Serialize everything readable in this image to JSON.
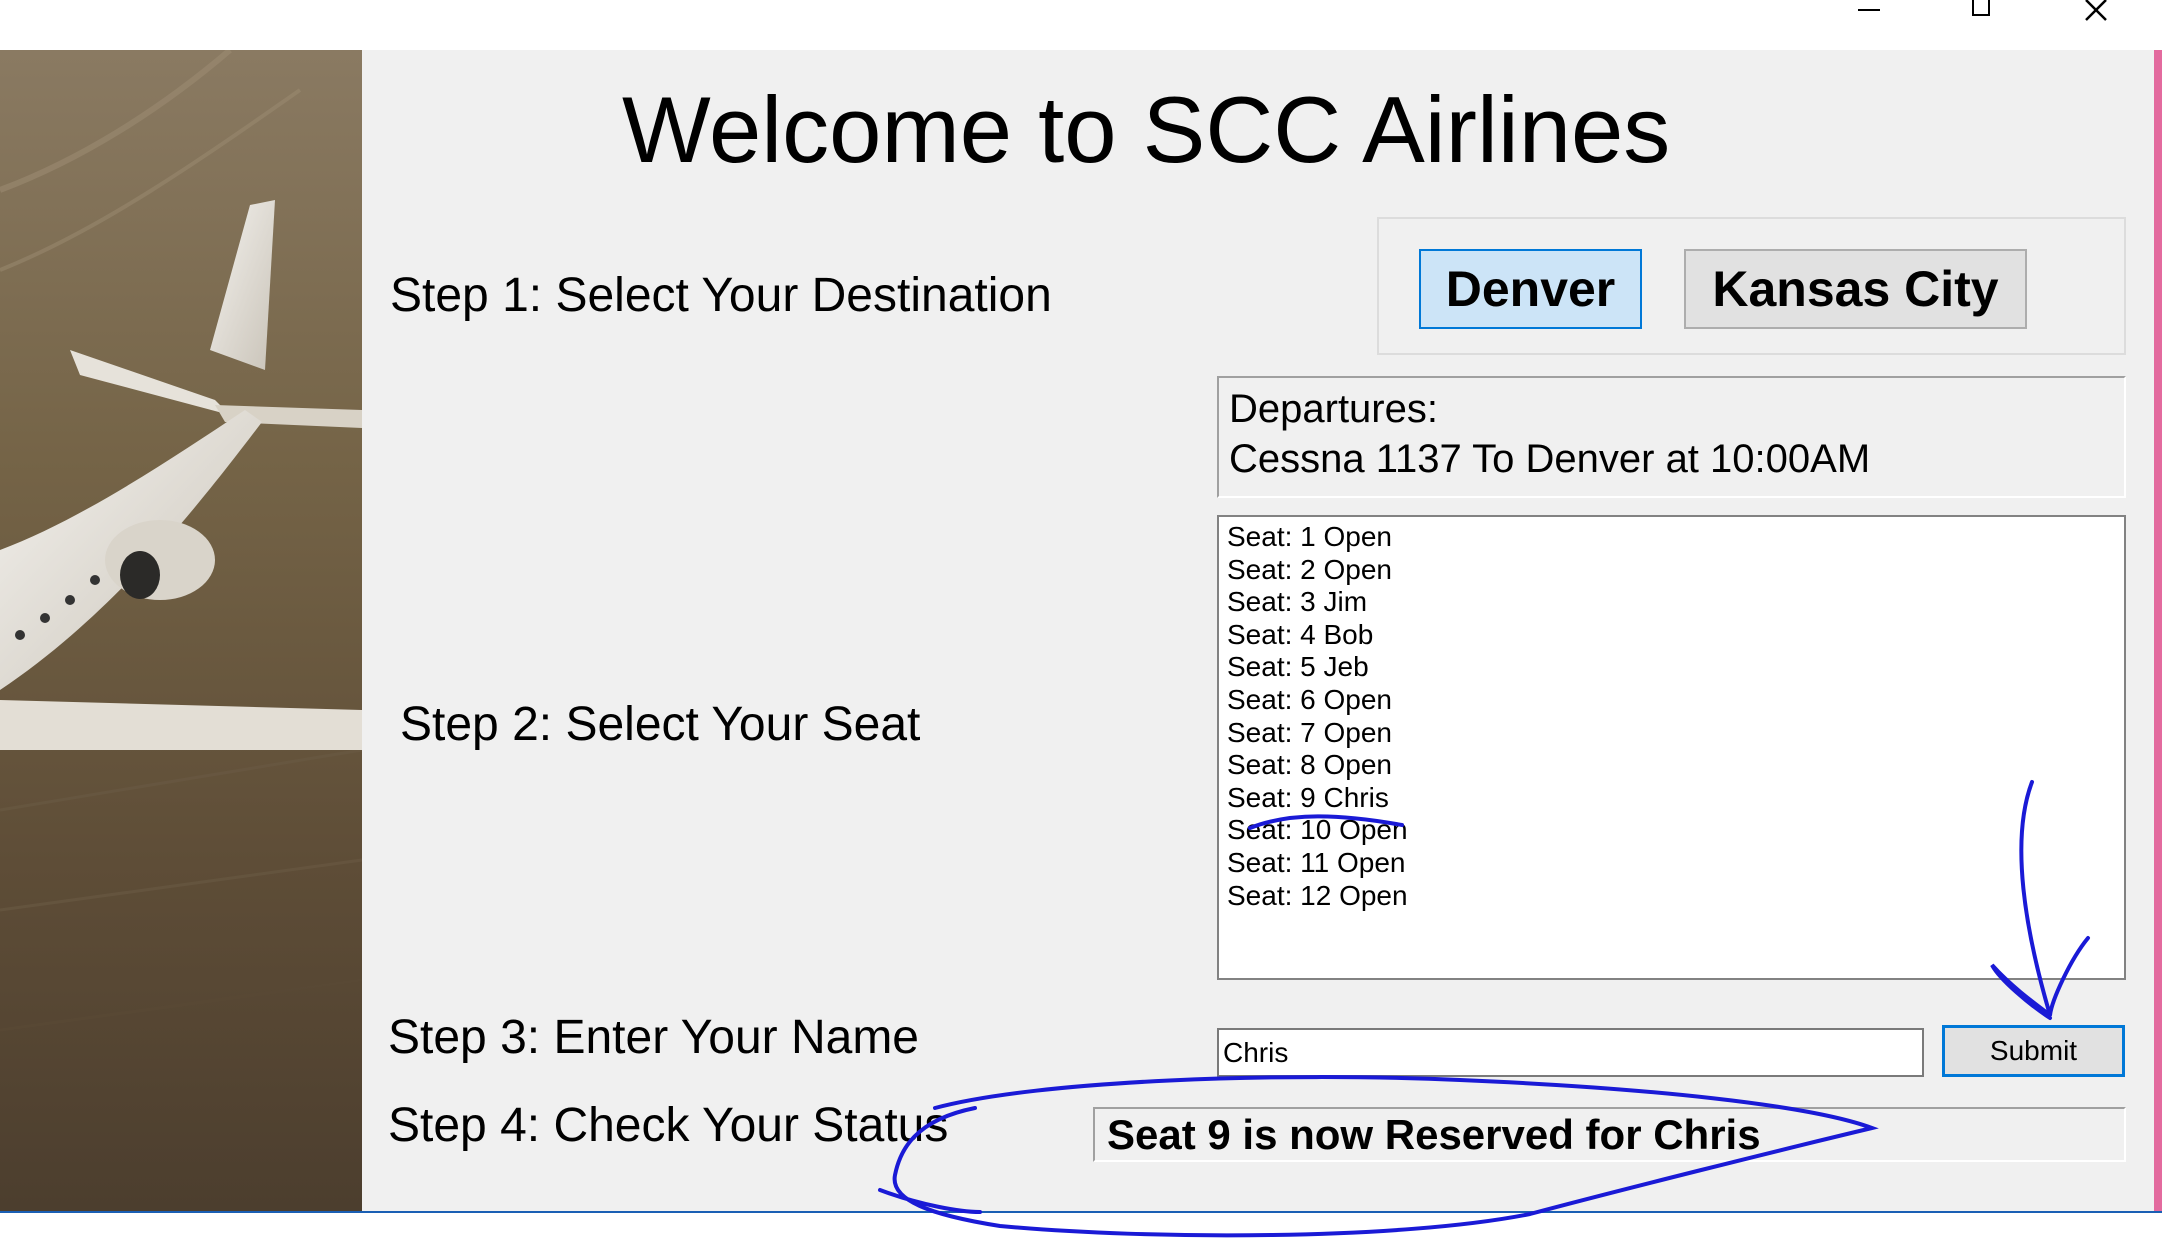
{
  "app": {
    "title": "Welcome to SCC Airlines"
  },
  "window_controls": {
    "minimize_icon": "minimize-icon",
    "maximize_icon": "maximize-icon",
    "close_icon": "close-icon"
  },
  "steps": {
    "step1": "Step 1: Select Your Destination",
    "step2": "Step 2: Select Your Seat",
    "step3": "Step 3: Enter Your Name",
    "step4": "Step 4: Check Your Status"
  },
  "destinations": {
    "denver": "Denver",
    "kansas_city": "Kansas City"
  },
  "departures": {
    "heading": "Departures:",
    "flight": "Cessna 1137 To Denver at 10:00AM"
  },
  "seats": [
    "Seat: 1 Open",
    "Seat: 2 Open",
    "Seat: 3 Jim",
    "Seat: 4 Bob",
    "Seat: 5 Jeb",
    "Seat: 6 Open",
    "Seat: 7 Open",
    "Seat: 8 Open",
    "Seat: 9 Chris",
    "Seat: 10 Open",
    "Seat: 11 Open",
    "Seat: 12 Open"
  ],
  "name_input": {
    "value": "Chris"
  },
  "submit": {
    "label": "Submit"
  },
  "status": {
    "text": "Seat 9 is now Reserved for Chris"
  },
  "colors": {
    "form_background": "#f0f0f0",
    "accent": "#0078d7",
    "annotation_ink": "#1a1ad6"
  }
}
